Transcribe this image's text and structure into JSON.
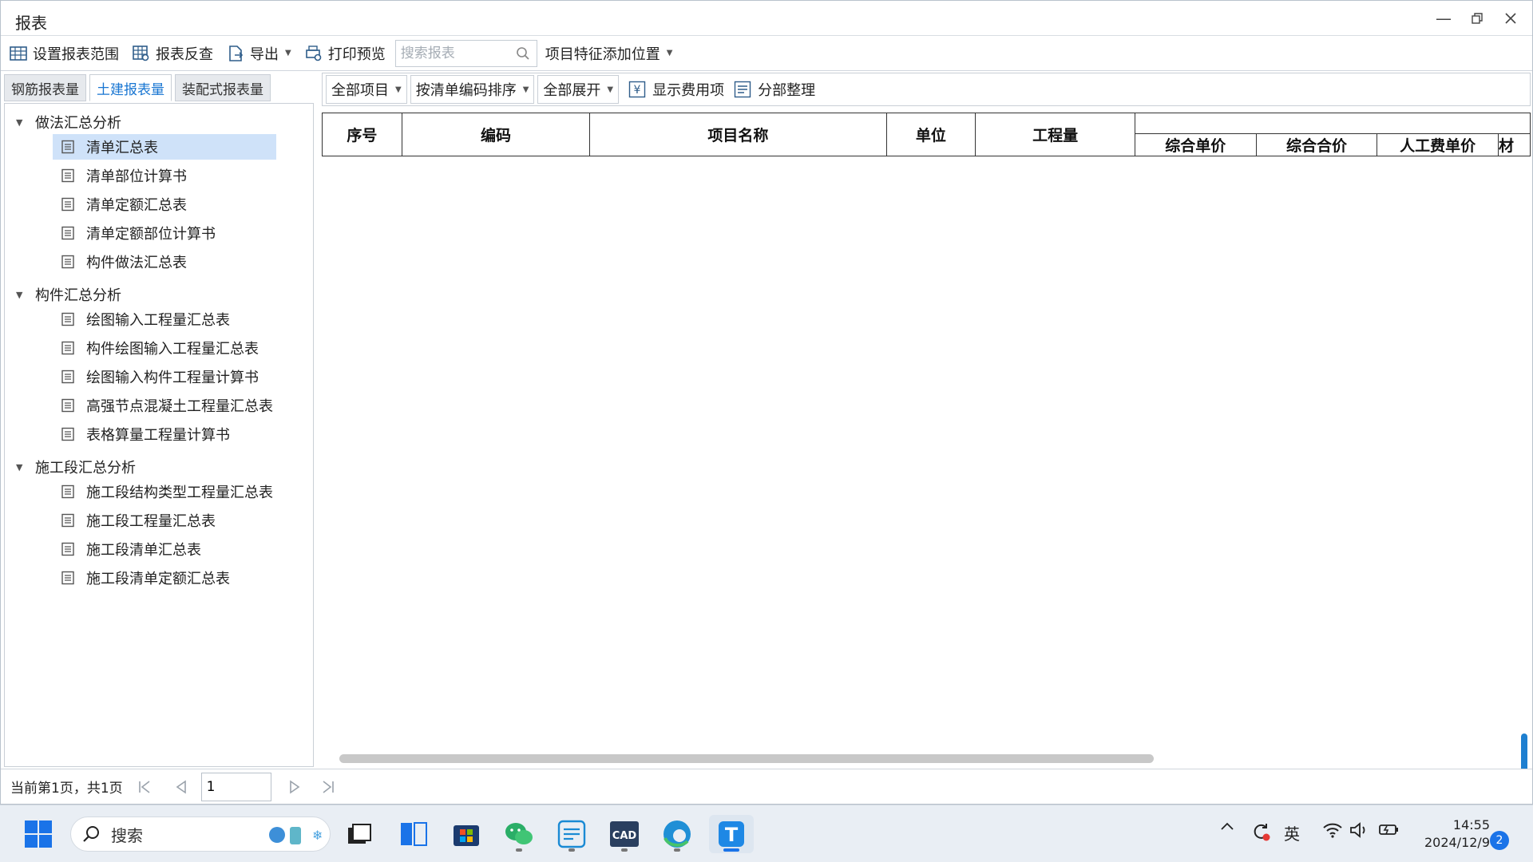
{
  "window": {
    "title": "报表"
  },
  "toolbar": {
    "set_range": "设置报表范围",
    "reverse_check": "报表反查",
    "export": "导出",
    "print_preview": "打印预览",
    "search_placeholder": "搜索报表",
    "feature_position": "项目特征添加位置"
  },
  "left_tabs": [
    "钢筋报表量",
    "土建报表量",
    "装配式报表量"
  ],
  "tree": {
    "groups": [
      {
        "label": "做法汇总分析",
        "items": [
          "清单汇总表",
          "清单部位计算书",
          "清单定额汇总表",
          "清单定额部位计算书",
          "构件做法汇总表"
        ]
      },
      {
        "label": "构件汇总分析",
        "items": [
          "绘图输入工程量汇总表",
          "构件绘图输入工程量汇总表",
          "绘图输入构件工程量计算书",
          "高强节点混凝土工程量汇总表",
          "表格算量工程量计算书"
        ]
      },
      {
        "label": "施工段汇总分析",
        "items": [
          "施工段结构类型工程量汇总表",
          "施工段工程量汇总表",
          "施工段清单汇总表",
          "施工段清单定额汇总表"
        ]
      }
    ],
    "selected": "清单汇总表"
  },
  "right_toolbar": {
    "all_items": "全部项目",
    "sort": "按清单编码排序",
    "expand": "全部展开",
    "show_fee": "显示费用项",
    "partition": "分部整理"
  },
  "table": {
    "headers": [
      "序号",
      "编码",
      "项目名称",
      "单位",
      "工程量"
    ],
    "sub_headers": [
      "综合单价",
      "综合合价",
      "人工费单价",
      "材"
    ]
  },
  "status": {
    "page_text": "当前第1页，共1页",
    "page_value": "1"
  },
  "taskbar": {
    "search": "搜索",
    "ime": "英",
    "time": "14:55",
    "date": "2024/12/9",
    "badge": "2"
  },
  "colors": {
    "accent": "#1976d2",
    "selected_row": "#cfe2f9"
  }
}
